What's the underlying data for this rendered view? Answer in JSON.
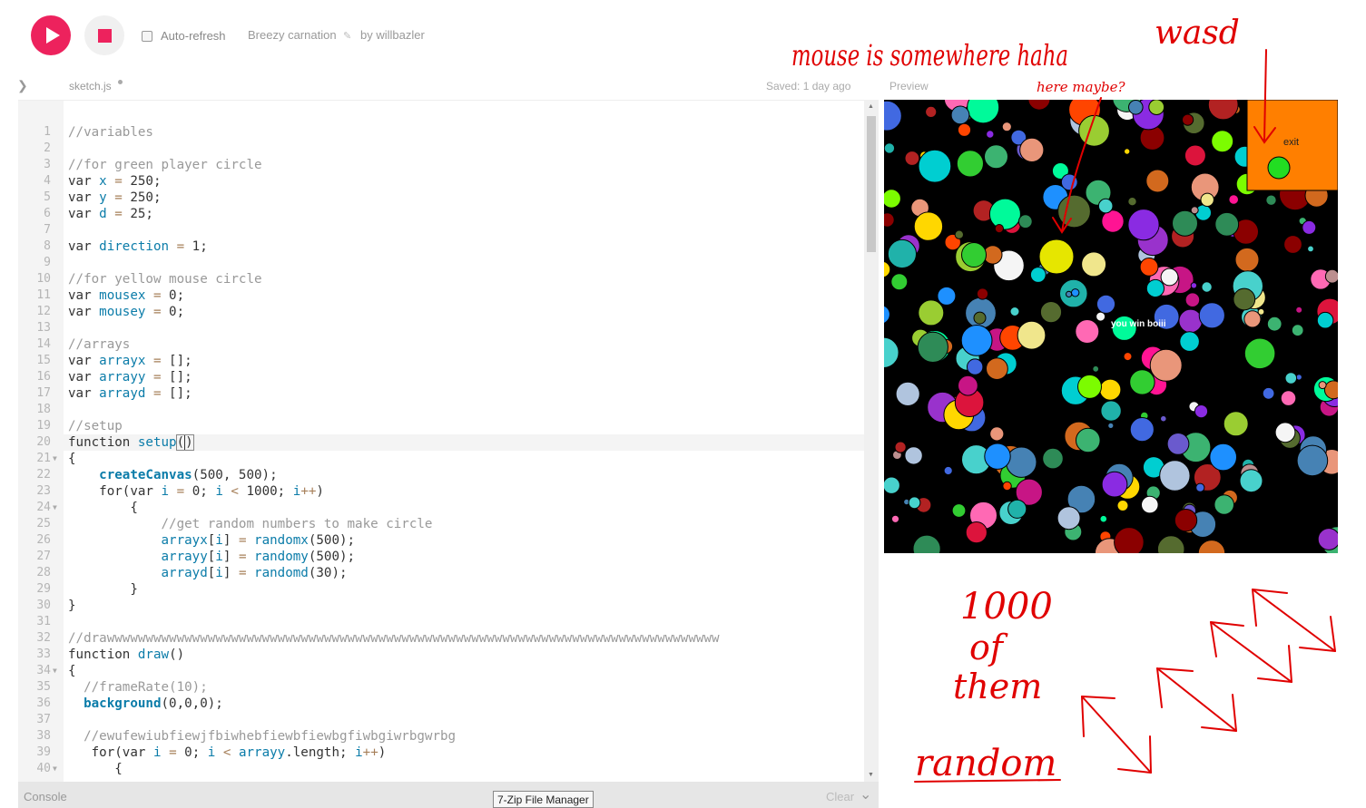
{
  "toolbar": {
    "play_icon": "play-icon",
    "stop_icon": "stop-icon",
    "auto_refresh_label": "Auto-refresh",
    "sketch_name": "Breezy carnation",
    "author": "by willbazler"
  },
  "editor": {
    "file_name": "sketch.js",
    "saved_status": "Saved: 1 day ago",
    "preview_label": "Preview",
    "lines": [
      {
        "n": "1",
        "text": "//variables"
      },
      {
        "n": "2",
        "text": ""
      },
      {
        "n": "3",
        "text": "//for green player circle"
      },
      {
        "n": "4",
        "text": "var x = 250;"
      },
      {
        "n": "5",
        "text": "var y = 250;"
      },
      {
        "n": "6",
        "text": "var d = 25;"
      },
      {
        "n": "7",
        "text": ""
      },
      {
        "n": "8",
        "text": "var direction = 1;"
      },
      {
        "n": "9",
        "text": ""
      },
      {
        "n": "10",
        "text": "//for yellow mouse circle"
      },
      {
        "n": "11",
        "text": "var mousex = 0;"
      },
      {
        "n": "12",
        "text": "var mousey = 0;"
      },
      {
        "n": "13",
        "text": ""
      },
      {
        "n": "14",
        "text": "//arrays"
      },
      {
        "n": "15",
        "text": "var arrayx = [];"
      },
      {
        "n": "16",
        "text": "var arrayy = [];"
      },
      {
        "n": "17",
        "text": "var arrayd = [];"
      },
      {
        "n": "18",
        "text": ""
      },
      {
        "n": "19",
        "text": "//setup"
      },
      {
        "n": "20",
        "text": "function setup()"
      },
      {
        "n": "21",
        "text": "{"
      },
      {
        "n": "22",
        "text": "    createCanvas(500, 500);"
      },
      {
        "n": "23",
        "text": "    for(var i = 0; i < 1000; i++)"
      },
      {
        "n": "24",
        "text": "        {"
      },
      {
        "n": "25",
        "text": "            //get random numbers to make circle"
      },
      {
        "n": "26",
        "text": "            arrayx[i] = randomx(500);"
      },
      {
        "n": "27",
        "text": "            arrayy[i] = randomy(500);"
      },
      {
        "n": "28",
        "text": "            arrayd[i] = randomd(30);"
      },
      {
        "n": "29",
        "text": "        }"
      },
      {
        "n": "30",
        "text": "}"
      },
      {
        "n": "31",
        "text": ""
      },
      {
        "n": "32",
        "text": "//drawwwwwwwwwwwwwwwwwwwwwwwwwwwwwwwwwwwwwwwwwwwwwwwwwwwwwwwwwwwwwwwwwwwwwwwwwwwwwww"
      },
      {
        "n": "33",
        "text": "function draw()"
      },
      {
        "n": "34",
        "text": "{"
      },
      {
        "n": "35",
        "text": "  //frameRate(10);"
      },
      {
        "n": "36",
        "text": "  background(0,0,0);"
      },
      {
        "n": "37",
        "text": ""
      },
      {
        "n": "38",
        "text": "  //ewufewiubfiewjfbiwhebfiewbfiewbgfiwbgiwrbgwrbg"
      },
      {
        "n": "39",
        "text": "   for(var i = 0; i < arrayy.length; i++)"
      },
      {
        "n": "40",
        "text": "      {"
      }
    ]
  },
  "console": {
    "label": "Console",
    "clear_label": "Clear"
  },
  "taskbar_tooltip": "7-Zip File Manager",
  "preview": {
    "exit_label": "exit",
    "win_text": "you win boiii",
    "exit_box_color": "#ff7f00",
    "player_color": "#22dd22",
    "mouse_circle_color": "#e6e600"
  },
  "annotations": {
    "mouse_note": "mouse is somewhere haha",
    "here_note": "here maybe?",
    "wasd_note": "wasd",
    "count_line1": "1000",
    "count_line2": "of",
    "count_line3": "them",
    "random_note": "random",
    "ink_color": "#e00000"
  }
}
